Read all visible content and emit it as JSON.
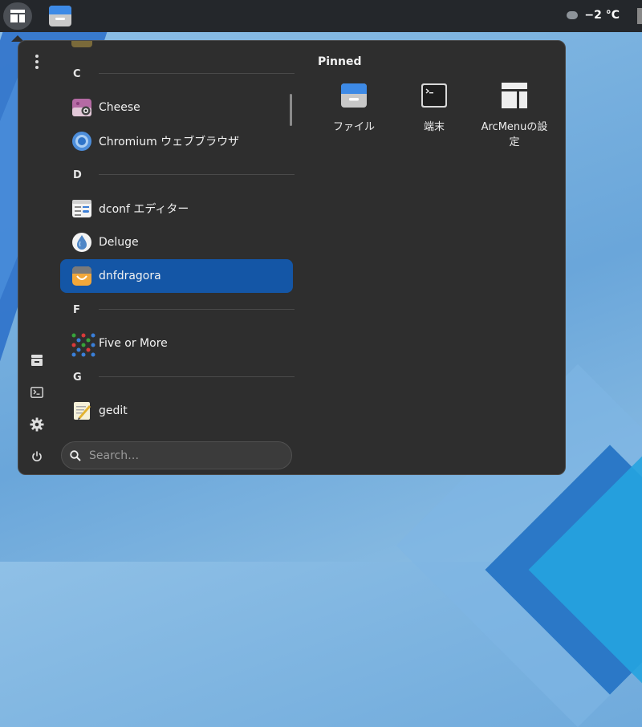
{
  "topbar": {
    "weather_temp": "−2 °C"
  },
  "menu": {
    "sections": [
      {
        "letter": "C",
        "apps": [
          {
            "label": "Cheese",
            "icon": "cheese-icon"
          },
          {
            "label": "Chromium ウェブブラウザ",
            "icon": "chromium-icon"
          }
        ]
      },
      {
        "letter": "D",
        "apps": [
          {
            "label": "dconf エディター",
            "icon": "dconf-icon"
          },
          {
            "label": "Deluge",
            "icon": "deluge-icon"
          },
          {
            "label": "dnfdragora",
            "icon": "dnfdragora-icon",
            "selected": true
          }
        ]
      },
      {
        "letter": "F",
        "apps": [
          {
            "label": "Five or More",
            "icon": "five-or-more-icon"
          }
        ]
      },
      {
        "letter": "G",
        "apps": [
          {
            "label": "gedit",
            "icon": "gedit-icon"
          }
        ]
      }
    ],
    "search_placeholder": "Search…",
    "pinned_title": "Pinned",
    "pinned": [
      {
        "label": "ファイル",
        "icon": "files-icon"
      },
      {
        "label": "端末",
        "icon": "terminal-icon"
      },
      {
        "label": "ArcMenuの設定",
        "icon": "arcmenu-settings-icon"
      }
    ],
    "sidebar_icons": [
      "more-options-icon",
      "files-icon",
      "terminal-icon",
      "settings-icon",
      "power-icon"
    ]
  },
  "colors": {
    "accent": "#1456a6",
    "panel_bg": "#2e2e2e",
    "topbar_bg": "#24272b"
  }
}
